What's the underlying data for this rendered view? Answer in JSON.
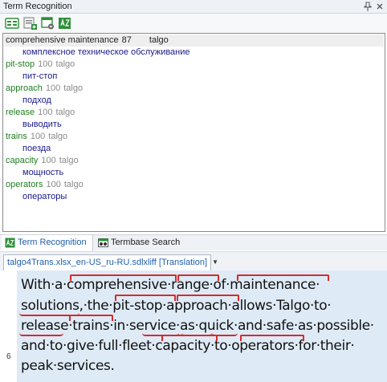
{
  "panel": {
    "title": "Term Recognition"
  },
  "toolbar": {
    "buttons": [
      {
        "name": "term-view-icon"
      },
      {
        "name": "add-term-icon"
      },
      {
        "name": "termbase-settings-icon"
      },
      {
        "name": "sort-az-icon"
      }
    ]
  },
  "results": {
    "header": {
      "source": "comprehensive maintenance",
      "score": "87",
      "termbase": "talgo"
    },
    "first_target": "комплексное техническое обслуживание",
    "terms": [
      {
        "source": "pit-stop",
        "score": "100",
        "termbase": "talgo",
        "target": "пит-стоп"
      },
      {
        "source": "approach",
        "score": "100",
        "termbase": "talgo",
        "target": "подход"
      },
      {
        "source": "release",
        "score": "100",
        "termbase": "talgo",
        "target": "выводить"
      },
      {
        "source": "trains",
        "score": "100",
        "termbase": "talgo",
        "target": "поезда"
      },
      {
        "source": "capacity",
        "score": "100",
        "termbase": "talgo",
        "target": "мощность"
      },
      {
        "source": "operators",
        "score": "100",
        "termbase": "talgo",
        "target": "операторы"
      }
    ]
  },
  "tabs": {
    "term_recognition": "Term Recognition",
    "termbase_search": "Termbase Search"
  },
  "document": {
    "tab_label": "talgo4Trans.xlsx_en-US_ru-RU.sdlxliff [Translation]"
  },
  "segment": {
    "number": "6",
    "lines": [
      "With·a·comprehensive·range·of·maintenance·",
      "solutions,·the·pit-stop·approach·allows·Talgo·to·",
      "release·trains·in·service·as·quick·and·safe·as·possible·",
      "and·to·give·full·fleet·capacity·to·operators·for·their·",
      "peak·services."
    ]
  },
  "colors": {
    "term_source": "#1e7e1e",
    "term_target": "#1a1a8c",
    "active_tab": "#1f5fae",
    "segment_bg": "#deebf7",
    "term_marker": "#d62b2b"
  }
}
